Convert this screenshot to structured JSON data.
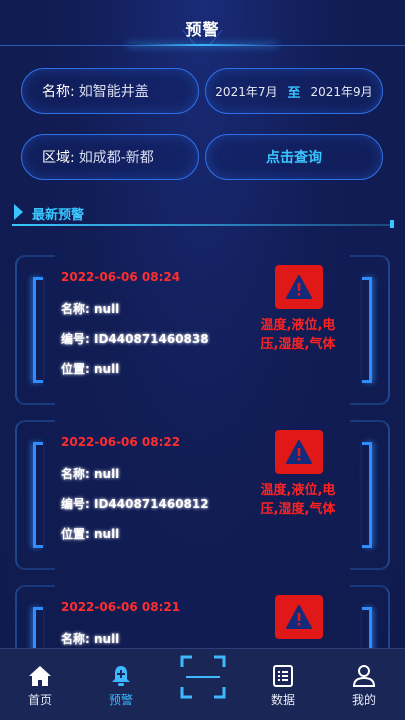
{
  "header": {
    "title": "预警"
  },
  "filters": {
    "name_label": "名称:",
    "name_value": "如智能井盖",
    "date_start": "2021年7月",
    "date_separator": "至",
    "date_end": "2021年9月",
    "area_label": "区域:",
    "area_value": "如成都-新都",
    "query_button": "点击查询"
  },
  "section": {
    "title": "最新预警"
  },
  "alerts": [
    {
      "time": "2022-06-06 08:24",
      "name": "名称:  null",
      "code": "编号:  ID440871460838",
      "location": "位置:  null",
      "types_line1": "温度,液位,电",
      "types_line2": "压,湿度,气体"
    },
    {
      "time": "2022-06-06 08:22",
      "name": "名称:  null",
      "code": "编号:  ID440871460812",
      "location": "位置:  null",
      "types_line1": "温度,液位,电",
      "types_line2": "压,湿度,气体"
    },
    {
      "time": "2022-06-06 08:21",
      "name": "名称:  null",
      "code": "",
      "location": "",
      "types_line1": "",
      "types_line2": ""
    }
  ],
  "nav": {
    "items": [
      {
        "label": "首页",
        "icon": "home-icon"
      },
      {
        "label": "预警",
        "icon": "bell-icon"
      },
      {
        "label": "",
        "icon": "scan-icon"
      },
      {
        "label": "数据",
        "icon": "list-icon"
      },
      {
        "label": "我的",
        "icon": "user-icon"
      }
    ],
    "active_color": "#3fb8ff"
  },
  "colors": {
    "alert_red": "#e01818",
    "accent": "#39c6ff",
    "background": "#111d55"
  }
}
